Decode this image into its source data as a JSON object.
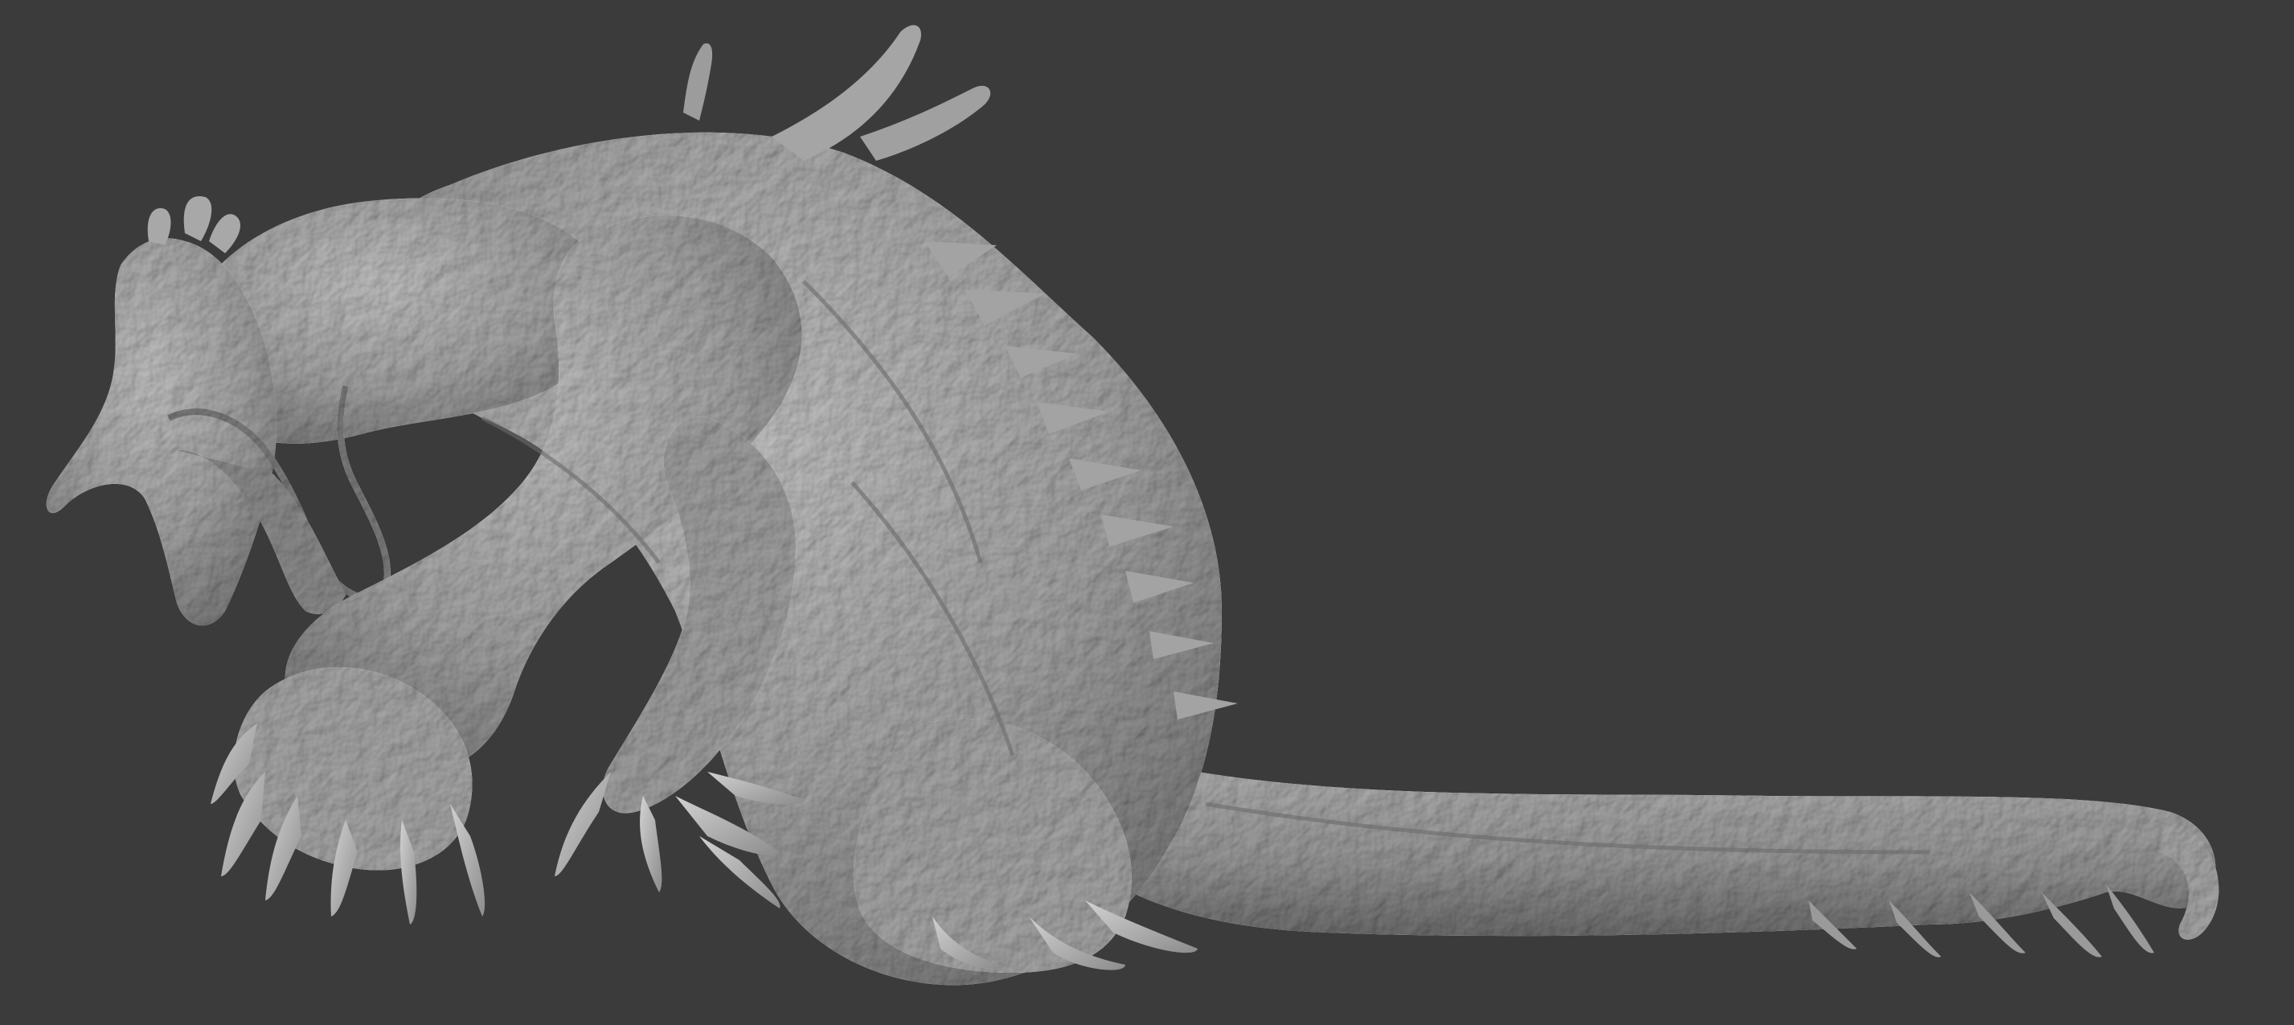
{
  "scene": {
    "subject": "sculpted-creature-model",
    "colors": {
      "background": "#3b3b3b",
      "clay_light": "#b9b9b9",
      "clay_mid": "#9e9e9e",
      "clay_dark": "#6c6c6c",
      "clay_shadow": "#4e4e4e"
    }
  }
}
